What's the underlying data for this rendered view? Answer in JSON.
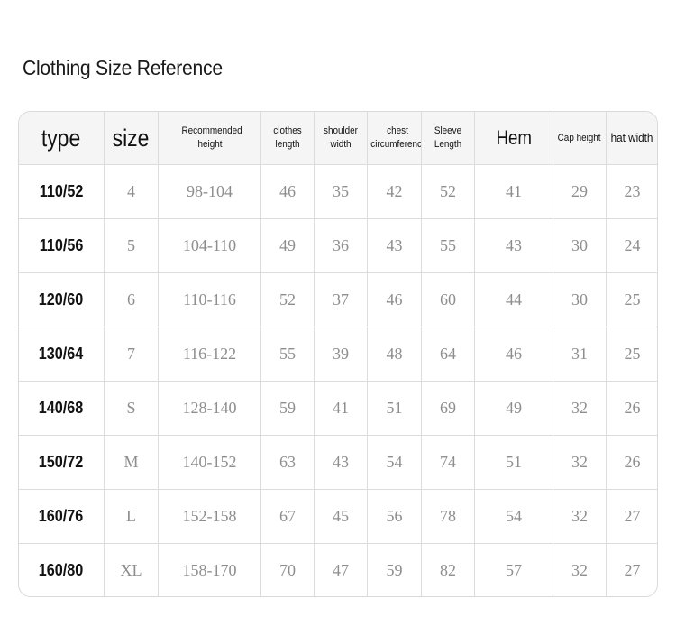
{
  "page": {
    "title": "Clothing Size Reference"
  },
  "table": {
    "headers": [
      "type",
      "size",
      "Recommended height",
      "clothes length",
      "shoulder width",
      "chest circumference",
      "Sleeve Length",
      "Hem",
      "Cap height",
      "hat width"
    ],
    "rows": [
      [
        "110/52",
        "4",
        "98-104",
        "46",
        "35",
        "42",
        "52",
        "41",
        "29",
        "23"
      ],
      [
        "110/56",
        "5",
        "104-110",
        "49",
        "36",
        "43",
        "55",
        "43",
        "30",
        "24"
      ],
      [
        "120/60",
        "6",
        "110-116",
        "52",
        "37",
        "46",
        "60",
        "44",
        "30",
        "25"
      ],
      [
        "130/64",
        "7",
        "116-122",
        "55",
        "39",
        "48",
        "64",
        "46",
        "31",
        "25"
      ],
      [
        "140/68",
        "S",
        "128-140",
        "59",
        "41",
        "51",
        "69",
        "49",
        "32",
        "26"
      ],
      [
        "150/72",
        "M",
        "140-152",
        "63",
        "43",
        "54",
        "74",
        "51",
        "32",
        "26"
      ],
      [
        "160/76",
        "L",
        "152-158",
        "67",
        "45",
        "56",
        "78",
        "54",
        "32",
        "27"
      ],
      [
        "160/80",
        "XL",
        "158-170",
        "70",
        "47",
        "59",
        "82",
        "57",
        "32",
        "27"
      ]
    ]
  }
}
